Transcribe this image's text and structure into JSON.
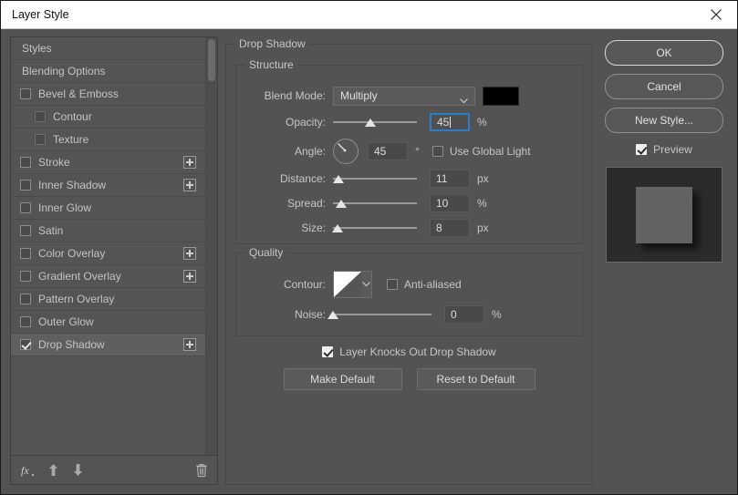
{
  "window": {
    "title": "Layer Style",
    "close_icon": "close-icon"
  },
  "styles_panel": {
    "items": [
      {
        "label": "Styles",
        "checkbox": "none",
        "indent": 0,
        "plus": false,
        "selected": false
      },
      {
        "label": "Blending Options",
        "checkbox": "none",
        "indent": 0,
        "plus": false,
        "selected": false
      },
      {
        "label": "Bevel & Emboss",
        "checkbox": "unchecked",
        "indent": 0,
        "plus": false,
        "selected": false
      },
      {
        "label": "Contour",
        "checkbox": "disabled",
        "indent": 1,
        "plus": false,
        "selected": false
      },
      {
        "label": "Texture",
        "checkbox": "disabled",
        "indent": 1,
        "plus": false,
        "selected": false
      },
      {
        "label": "Stroke",
        "checkbox": "unchecked",
        "indent": 0,
        "plus": true,
        "selected": false
      },
      {
        "label": "Inner Shadow",
        "checkbox": "unchecked",
        "indent": 0,
        "plus": true,
        "selected": false
      },
      {
        "label": "Inner Glow",
        "checkbox": "unchecked",
        "indent": 0,
        "plus": false,
        "selected": false
      },
      {
        "label": "Satin",
        "checkbox": "unchecked",
        "indent": 0,
        "plus": false,
        "selected": false
      },
      {
        "label": "Color Overlay",
        "checkbox": "unchecked",
        "indent": 0,
        "plus": true,
        "selected": false
      },
      {
        "label": "Gradient Overlay",
        "checkbox": "unchecked",
        "indent": 0,
        "plus": true,
        "selected": false
      },
      {
        "label": "Pattern Overlay",
        "checkbox": "unchecked",
        "indent": 0,
        "plus": false,
        "selected": false
      },
      {
        "label": "Outer Glow",
        "checkbox": "unchecked",
        "indent": 0,
        "plus": false,
        "selected": false
      },
      {
        "label": "Drop Shadow",
        "checkbox": "checked",
        "indent": 0,
        "plus": true,
        "selected": true
      }
    ],
    "toolbar": {
      "fx_label": "fx",
      "move_up_icon": "arrow-up-icon",
      "move_down_icon": "arrow-down-icon",
      "delete_icon": "trash-icon"
    }
  },
  "drop_shadow": {
    "section_title": "Drop Shadow",
    "structure": {
      "legend": "Structure",
      "blend_mode": {
        "label": "Blend Mode:",
        "value": "Multiply",
        "color": "#000000"
      },
      "opacity": {
        "label": "Opacity:",
        "value": "45",
        "unit": "%",
        "slider_percent": 45,
        "focused": true
      },
      "angle": {
        "label": "Angle:",
        "value": "45",
        "unit": "°",
        "use_global_light": {
          "label": "Use Global Light",
          "checked": false
        }
      },
      "distance": {
        "label": "Distance:",
        "value": "11",
        "unit": "px",
        "slider_percent": 6
      },
      "spread": {
        "label": "Spread:",
        "value": "10",
        "unit": "%",
        "slider_percent": 10
      },
      "size": {
        "label": "Size:",
        "value": "8",
        "unit": "px",
        "slider_percent": 5
      }
    },
    "quality": {
      "legend": "Quality",
      "contour": {
        "label": "Contour:",
        "anti_aliased": {
          "label": "Anti-aliased",
          "checked": false
        }
      },
      "noise": {
        "label": "Noise:",
        "value": "0",
        "unit": "%",
        "slider_percent": 0
      }
    },
    "knockout": {
      "label": "Layer Knocks Out Drop Shadow",
      "checked": true
    },
    "make_default_label": "Make Default",
    "reset_default_label": "Reset to Default"
  },
  "actions": {
    "ok_label": "OK",
    "cancel_label": "Cancel",
    "new_style_label": "New Style...",
    "preview": {
      "label": "Preview",
      "checked": true
    }
  }
}
